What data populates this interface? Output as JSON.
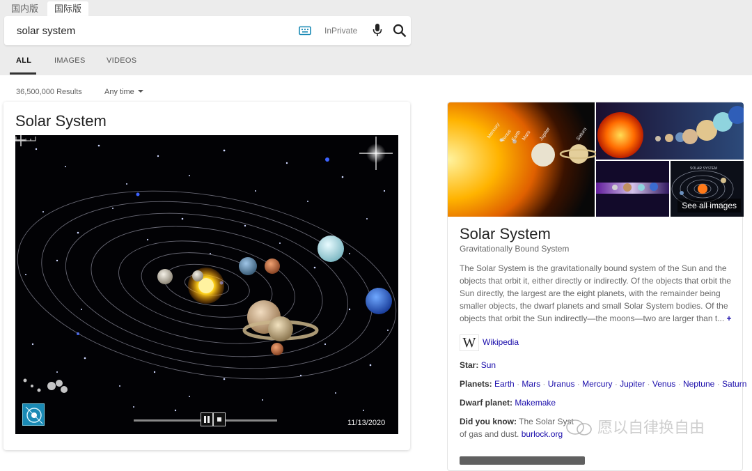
{
  "header": {
    "region_tabs": [
      "国内版",
      "国际版"
    ],
    "active_region": 1
  },
  "search": {
    "query": "solar system",
    "inprivate_label": "InPrivate",
    "icons": [
      "keyboard-icon",
      "microphone-icon",
      "search-icon"
    ]
  },
  "nav": {
    "tabs": [
      "ALL",
      "IMAGES",
      "VIDEOS"
    ],
    "active": "ALL"
  },
  "results": {
    "count": "36,500,000 Results",
    "time_filter": "Any time"
  },
  "video_card": {
    "title": "Solar System",
    "date": "11/13/2020",
    "controls": [
      "minus-icon",
      "pause-icon",
      "stop-icon",
      "plus-icon"
    ]
  },
  "knowledge_panel": {
    "see_all_images": "See all images",
    "mosaic_labels": [
      "Mercury",
      "Venus",
      "Earth",
      "Mars",
      "Jupiter",
      "Saturn"
    ],
    "mosaic_inset_title": "SOLAR SYSTEM",
    "title": "Solar System",
    "subtitle": "Gravitationally Bound System",
    "description": "The Solar System is the gravitationally bound system of the Sun and the objects that orbit it, either directly or indirectly. Of the objects that orbit the Sun directly, the largest are the eight planets, with the remainder being smaller objects, the dwarf planets and small Solar System bodies. Of the objects that orbit the Sun indirectly—the moons—two are larger than t...",
    "more_symbol": "+",
    "wikipedia_label": "Wikipedia",
    "wikipedia_logo": "W",
    "facts": {
      "star_label": "Star:",
      "star_value": "Sun",
      "planets_label": "Planets:",
      "planets": [
        "Earth",
        "Mars",
        "Uranus",
        "Mercury",
        "Jupiter",
        "Venus",
        "Neptune",
        "Saturn"
      ],
      "separator": "·",
      "dwarf_label": "Dwarf planet:",
      "dwarf_value": "Makemake",
      "didyouknow_label": "Did you know:",
      "didyouknow_text_1": "The Solar Syst",
      "didyouknow_text_2": "of gas and dust.",
      "didyouknow_link": "burlock.org"
    }
  },
  "watermark": {
    "text": "愿以自律换自由"
  },
  "colors": {
    "link": "#1a0dab",
    "topbar": "#ececec",
    "keyboard_icon": "#1a8ab5"
  }
}
